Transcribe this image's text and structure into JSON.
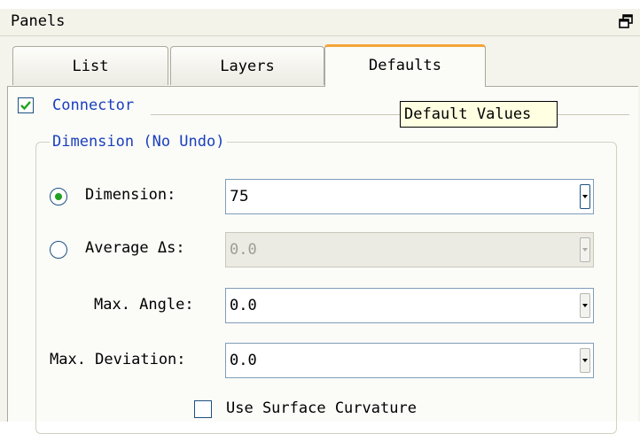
{
  "panel": {
    "title": "Panels"
  },
  "tabs": [
    {
      "label": "List",
      "active": false
    },
    {
      "label": "Layers",
      "active": false
    },
    {
      "label": "Defaults",
      "active": true
    }
  ],
  "connector": {
    "label": "Connector",
    "checked": true
  },
  "tooltip": "Default Values",
  "dimension_group": {
    "title": "Dimension (No Undo)"
  },
  "fields": {
    "dimension": {
      "label": "Dimension:",
      "value": "75",
      "selected": true
    },
    "average_ds": {
      "label": "Average Δs:",
      "value": "0.0",
      "selected": false,
      "disabled": true
    },
    "max_angle": {
      "label": "Max. Angle:",
      "value": "0.0"
    },
    "max_deviation": {
      "label": "Max. Deviation:",
      "value": "0.0"
    }
  },
  "use_surface_curvature": {
    "label": "Use Surface Curvature",
    "checked": false
  },
  "colors": {
    "accent_tab": "#f3a437",
    "section_text": "#1a3fbf",
    "radio_selected": "#21a121"
  }
}
